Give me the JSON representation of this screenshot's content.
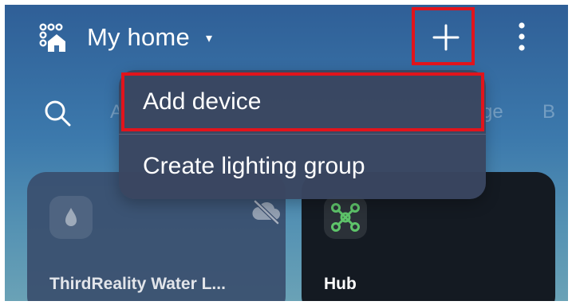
{
  "header": {
    "title": "My home",
    "caret": "▾",
    "home_icon": "home-switch-icon",
    "add_icon": "plus-icon",
    "more_icon": "more-vertical-icon"
  },
  "tabs": {
    "search_icon": "search-icon",
    "items": [
      "A",
      "ge",
      "B"
    ]
  },
  "menu": {
    "items": [
      {
        "label": "Add device"
      },
      {
        "label": "Create lighting group"
      }
    ]
  },
  "devices": [
    {
      "name": "ThirdReality Water L...",
      "icon": "water-drop-icon",
      "status_icon": "cloud-off-icon"
    },
    {
      "name": "Hub",
      "icon": "hub-icon"
    }
  ],
  "colors": {
    "highlight": "#e1141c",
    "hub_icon": "#5ec46a",
    "menu_bg": "#3a4660",
    "hub_card": "#141a22"
  }
}
